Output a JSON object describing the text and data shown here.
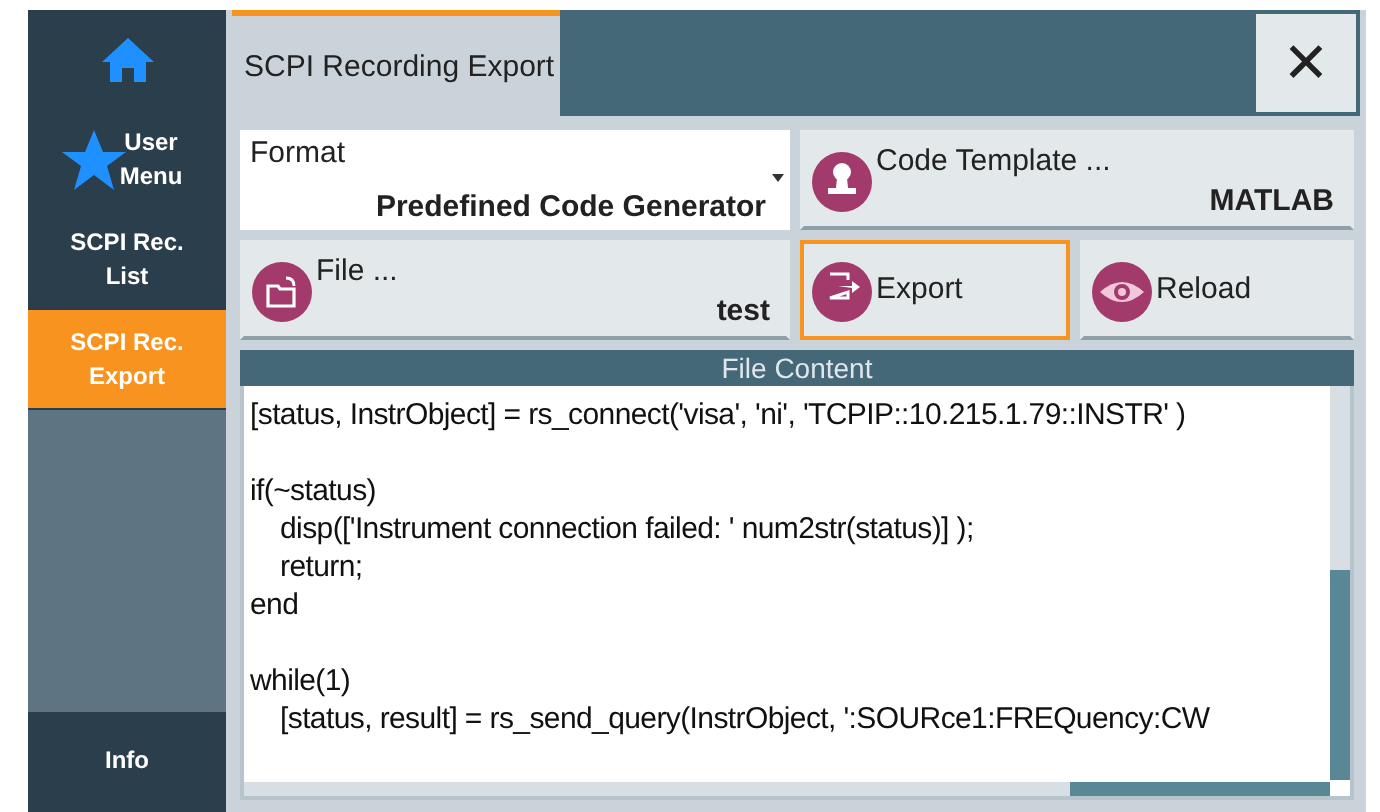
{
  "sidebar": {
    "items": [
      {
        "kind": "home",
        "selected": false
      },
      {
        "kind": "star",
        "label": "User Menu",
        "selected": false
      },
      {
        "kind": "text",
        "label": "SCPI Rec. List",
        "selected": false
      },
      {
        "kind": "text",
        "label": "SCPI Rec. Export",
        "selected": true
      },
      {
        "kind": "spacer",
        "selected": false
      },
      {
        "kind": "text",
        "label": "Info",
        "selected": false
      }
    ]
  },
  "tabs": [
    {
      "label": "SCPI Recording Export",
      "selected": true
    }
  ],
  "close_button": {
    "label": "✕"
  },
  "format": {
    "label": "Format",
    "value": "Predefined Code Generator"
  },
  "buttons": [
    {
      "kind": "template",
      "label": "Code Template ...",
      "value": "MATLAB",
      "focused": false
    },
    {
      "kind": "file",
      "label": "File ...",
      "value": "test",
      "focused": false
    },
    {
      "kind": "export",
      "label": "Export",
      "focused": true
    },
    {
      "kind": "reload",
      "label": "Reload",
      "focused": false
    }
  ],
  "file_content": {
    "title": "File Content",
    "lines": [
      {
        "kind": "code",
        "text": "[status, InstrObject] = rs_connect('visa', 'ni', 'TCPIP::10.215.1.79::INSTR' )",
        "indented": false
      },
      {
        "kind": "blank"
      },
      {
        "kind": "code",
        "text": "if(~status)",
        "indented": false
      },
      {
        "kind": "code",
        "text": "disp(['Instrument connection failed: ' num2str(status)] );",
        "indented": true
      },
      {
        "kind": "code",
        "text": "return;",
        "indented": true
      },
      {
        "kind": "code",
        "text": "end",
        "indented": false
      },
      {
        "kind": "blank"
      },
      {
        "kind": "code",
        "text": "while(1)",
        "indented": false
      },
      {
        "kind": "code",
        "text": "[status, result] = rs_send_query(InstrObject, ':SOURce1:FREQuency:CW",
        "indented": true
      }
    ]
  }
}
